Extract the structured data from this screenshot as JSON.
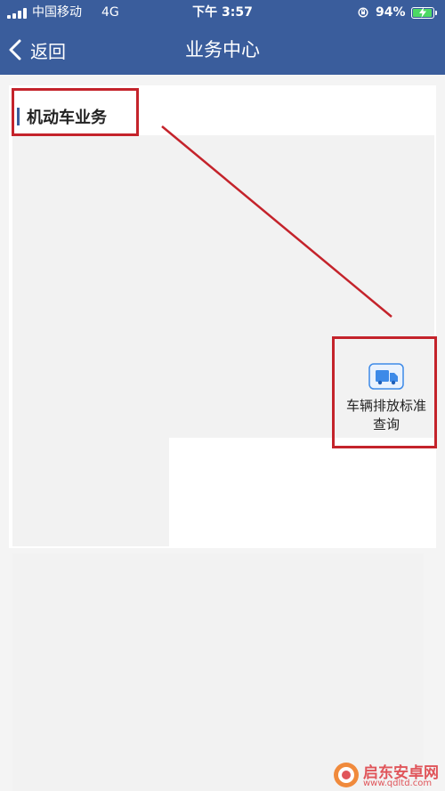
{
  "status_bar": {
    "carrier": "中国移动",
    "network": "4G",
    "time": "下午 3:57",
    "battery": "94%",
    "battery_level": 0.94
  },
  "nav": {
    "back_label": "返回",
    "title": "业务中心"
  },
  "section": {
    "heading": "机动车业务"
  },
  "service": {
    "label_line1": "车辆排放标准",
    "label_line2": "查询",
    "icon": "truck-icon"
  },
  "watermark": {
    "title": "启东安卓网",
    "url": "www.qdltd.com"
  },
  "colors": {
    "header": "#3a5d9c",
    "accent_bar": "#3a5d9c",
    "annotation": "#c4232b",
    "icon_blue": "#3d8ae8",
    "battery_fill": "#4cd964"
  }
}
